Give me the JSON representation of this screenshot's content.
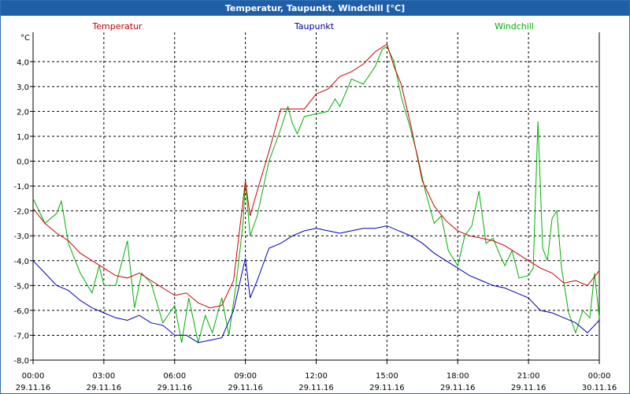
{
  "window": {
    "title": "Temperatur, Taupunkt, Windchill [°C]"
  },
  "colors": {
    "titlebar": "#1f5fa8",
    "temperatur": "#cc0000",
    "taupunkt": "#0000b0",
    "windchill": "#00b000",
    "grid": "#000000"
  },
  "chart_data": {
    "type": "line",
    "title": "Temperatur, Taupunkt, Windchill [°C]",
    "ylabel": "°C",
    "ylim": [
      -8,
      4.8
    ],
    "xlim": [
      0,
      24
    ],
    "grid": true,
    "legend_placement": "top",
    "yticks": [
      4,
      3,
      2,
      1,
      0,
      -1,
      -2,
      -3,
      -4,
      -5,
      -6,
      -7,
      -8
    ],
    "ytick_labels": [
      "4,0",
      "3,0",
      "2,0",
      "1,0",
      "0,0",
      "-1,0",
      "-2,0",
      "-3,0",
      "-4,0",
      "-5,0",
      "-6,0",
      "-7,0",
      "-8,0"
    ],
    "xticks": [
      0,
      3,
      6,
      9,
      12,
      15,
      18,
      21,
      24
    ],
    "xtick_times": [
      "00:00",
      "03:00",
      "06:00",
      "09:00",
      "12:00",
      "15:00",
      "18:00",
      "21:00",
      "00:00"
    ],
    "xtick_dates": [
      "29.11.16",
      "29.11.16",
      "29.11.16",
      "29.11.16",
      "29.11.16",
      "29.11.16",
      "29.11.16",
      "29.11.16",
      "30.11.16"
    ],
    "series": [
      {
        "name": "Temperatur",
        "color": "#cc0000",
        "points": [
          [
            0,
            -1.9
          ],
          [
            0.5,
            -2.5
          ],
          [
            1,
            -2.9
          ],
          [
            1.5,
            -3.2
          ],
          [
            2,
            -3.7
          ],
          [
            2.5,
            -4
          ],
          [
            3,
            -4.3
          ],
          [
            3.5,
            -4.6
          ],
          [
            4,
            -4.7
          ],
          [
            4.5,
            -4.5
          ],
          [
            5,
            -4.8
          ],
          [
            5.5,
            -5.1
          ],
          [
            6,
            -5.4
          ],
          [
            6.5,
            -5.3
          ],
          [
            7,
            -5.7
          ],
          [
            7.5,
            -5.9
          ],
          [
            8,
            -5.8
          ],
          [
            8.5,
            -4.8
          ],
          [
            9,
            -0.8
          ],
          [
            9.2,
            -2.2
          ],
          [
            9.5,
            -1.2
          ],
          [
            10,
            0.4
          ],
          [
            10.5,
            2.1
          ],
          [
            11,
            2.1
          ],
          [
            11.5,
            2.1
          ],
          [
            12,
            2.7
          ],
          [
            12.5,
            2.9
          ],
          [
            13,
            3.4
          ],
          [
            13.5,
            3.6
          ],
          [
            14,
            3.9
          ],
          [
            14.5,
            4.4
          ],
          [
            15,
            4.7
          ],
          [
            15.3,
            3.8
          ],
          [
            15.6,
            3.1
          ],
          [
            16,
            1.5
          ],
          [
            16.5,
            -0.8
          ],
          [
            17,
            -1.8
          ],
          [
            17.5,
            -2.4
          ],
          [
            18,
            -2.8
          ],
          [
            18.5,
            -3
          ],
          [
            19,
            -3.1
          ],
          [
            19.5,
            -3.2
          ],
          [
            20,
            -3.4
          ],
          [
            20.5,
            -3.7
          ],
          [
            21,
            -4
          ],
          [
            21.5,
            -4.3
          ],
          [
            22,
            -4.5
          ],
          [
            22.5,
            -4.9
          ],
          [
            23,
            -4.8
          ],
          [
            23.5,
            -5
          ],
          [
            24,
            -4.4
          ]
        ]
      },
      {
        "name": "Taupunkt",
        "color": "#0000b0",
        "points": [
          [
            0,
            -4
          ],
          [
            0.5,
            -4.5
          ],
          [
            1,
            -5
          ],
          [
            1.5,
            -5.2
          ],
          [
            2,
            -5.6
          ],
          [
            2.5,
            -5.9
          ],
          [
            3,
            -6.1
          ],
          [
            3.5,
            -6.3
          ],
          [
            4,
            -6.4
          ],
          [
            4.5,
            -6.2
          ],
          [
            5,
            -6.5
          ],
          [
            5.5,
            -6.6
          ],
          [
            6,
            -7
          ],
          [
            6.5,
            -7
          ],
          [
            7,
            -7.3
          ],
          [
            7.5,
            -7.2
          ],
          [
            8,
            -7.1
          ],
          [
            8.5,
            -6
          ],
          [
            9,
            -3.9
          ],
          [
            9.2,
            -5.5
          ],
          [
            9.5,
            -4.8
          ],
          [
            10,
            -3.5
          ],
          [
            10.5,
            -3.3
          ],
          [
            11,
            -3
          ],
          [
            11.5,
            -2.8
          ],
          [
            12,
            -2.7
          ],
          [
            12.5,
            -2.8
          ],
          [
            13,
            -2.9
          ],
          [
            13.5,
            -2.8
          ],
          [
            14,
            -2.7
          ],
          [
            14.5,
            -2.7
          ],
          [
            15,
            -2.6
          ],
          [
            15.5,
            -2.8
          ],
          [
            16,
            -3
          ],
          [
            16.5,
            -3.3
          ],
          [
            17,
            -3.7
          ],
          [
            17.5,
            -4
          ],
          [
            18,
            -4.3
          ],
          [
            18.5,
            -4.6
          ],
          [
            19,
            -4.8
          ],
          [
            19.5,
            -5
          ],
          [
            20,
            -5.1
          ],
          [
            20.5,
            -5.3
          ],
          [
            21,
            -5.5
          ],
          [
            21.5,
            -6
          ],
          [
            22,
            -6.1
          ],
          [
            22.5,
            -6.3
          ],
          [
            23,
            -6.5
          ],
          [
            23.5,
            -6.9
          ],
          [
            24,
            -6.4
          ]
        ]
      },
      {
        "name": "Windchill",
        "color": "#00b000",
        "points": [
          [
            0,
            -1.5
          ],
          [
            0.5,
            -2.5
          ],
          [
            1,
            -2.1
          ],
          [
            1.2,
            -1.6
          ],
          [
            1.5,
            -3.3
          ],
          [
            2,
            -4.5
          ],
          [
            2.5,
            -5.3
          ],
          [
            2.8,
            -4.2
          ],
          [
            3,
            -5
          ],
          [
            3.5,
            -5
          ],
          [
            4,
            -3.2
          ],
          [
            4.3,
            -5.9
          ],
          [
            4.6,
            -4.5
          ],
          [
            5,
            -4.9
          ],
          [
            5.5,
            -6.5
          ],
          [
            6,
            -5.8
          ],
          [
            6.3,
            -7.3
          ],
          [
            6.6,
            -5.5
          ],
          [
            7,
            -7.3
          ],
          [
            7.3,
            -6.2
          ],
          [
            7.6,
            -6.9
          ],
          [
            8,
            -5.5
          ],
          [
            8.3,
            -7
          ],
          [
            8.6,
            -5
          ],
          [
            8.9,
            -2.5
          ],
          [
            9,
            -0.8
          ],
          [
            9.2,
            -3
          ],
          [
            9.5,
            -2.2
          ],
          [
            10,
            0
          ],
          [
            10.5,
            1.3
          ],
          [
            10.8,
            2.2
          ],
          [
            11,
            1.5
          ],
          [
            11.2,
            1.1
          ],
          [
            11.5,
            1.8
          ],
          [
            12,
            1.9
          ],
          [
            12.5,
            2
          ],
          [
            12.8,
            2.5
          ],
          [
            13,
            2.2
          ],
          [
            13.5,
            3.3
          ],
          [
            14,
            3.1
          ],
          [
            14.5,
            3.8
          ],
          [
            14.8,
            4.5
          ],
          [
            15,
            4.6
          ],
          [
            15.3,
            4
          ],
          [
            15.6,
            2.6
          ],
          [
            16,
            1.3
          ],
          [
            16.3,
            0.2
          ],
          [
            16.6,
            -1.1
          ],
          [
            17,
            -2.5
          ],
          [
            17.3,
            -2.2
          ],
          [
            17.6,
            -3.6
          ],
          [
            18,
            -4.2
          ],
          [
            18.3,
            -3
          ],
          [
            18.6,
            -2.6
          ],
          [
            18.9,
            -1.2
          ],
          [
            19.2,
            -3.3
          ],
          [
            19.5,
            -3.1
          ],
          [
            19.8,
            -3.8
          ],
          [
            20,
            -4.2
          ],
          [
            20.3,
            -3.6
          ],
          [
            20.6,
            -4.7
          ],
          [
            21,
            -4.6
          ],
          [
            21.2,
            -4.3
          ],
          [
            21.4,
            1.6
          ],
          [
            21.6,
            -3.5
          ],
          [
            21.8,
            -4
          ],
          [
            22,
            -2.3
          ],
          [
            22.2,
            -2
          ],
          [
            22.4,
            -4.3
          ],
          [
            22.7,
            -6.1
          ],
          [
            23,
            -6.9
          ],
          [
            23.3,
            -6
          ],
          [
            23.6,
            -6.3
          ],
          [
            23.8,
            -4.5
          ],
          [
            24,
            -6.3
          ]
        ]
      }
    ]
  }
}
